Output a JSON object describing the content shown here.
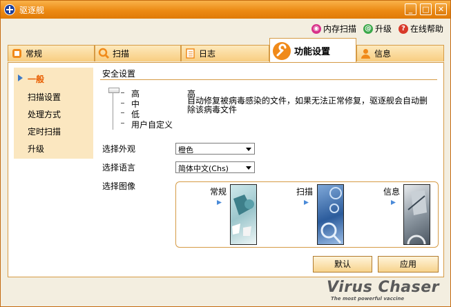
{
  "window": {
    "title": "驱逐舰"
  },
  "toplinks": [
    {
      "label": "内存扫描",
      "color": "#d8328a"
    },
    {
      "label": "升级",
      "color": "#3aa84a"
    },
    {
      "label": "在线帮助",
      "color": "#d83a2a"
    }
  ],
  "tabs": [
    {
      "label": "常规",
      "icon": "general-icon"
    },
    {
      "label": "扫描",
      "icon": "magnifier-icon"
    },
    {
      "label": "日志",
      "icon": "notebook-icon"
    },
    {
      "label": "功能设置",
      "icon": "wrench-icon",
      "active": true
    },
    {
      "label": "信息",
      "icon": "person-icon"
    }
  ],
  "sidebar": {
    "items": [
      {
        "label": "一般",
        "active": true
      },
      {
        "label": "扫描设置"
      },
      {
        "label": "处理方式"
      },
      {
        "label": "定时扫描"
      },
      {
        "label": "升级"
      }
    ]
  },
  "security": {
    "title": "安全设置",
    "levels": [
      "高",
      "中",
      "低",
      "用户自定义"
    ],
    "selected_level": "高",
    "description": "自动修复被病毒感染的文件，如果无法正常修复，驱逐舰会自动删除该病毒文件"
  },
  "appearance": {
    "label": "选择外观",
    "value": "橙色"
  },
  "language": {
    "label": "选择语言",
    "value": "简体中文(Chs)"
  },
  "image": {
    "label": "选择图像",
    "options": [
      {
        "label": "常规"
      },
      {
        "label": "扫描"
      },
      {
        "label": "信息"
      }
    ]
  },
  "buttons": {
    "default": "默认",
    "apply": "应用"
  },
  "brand": {
    "name": "Virus Chaser",
    "tagline": "The most powerful vaccine"
  },
  "colors": {
    "accent": "#ec8a14",
    "panel_border": "#d59a44",
    "active_text": "#e85d00"
  }
}
